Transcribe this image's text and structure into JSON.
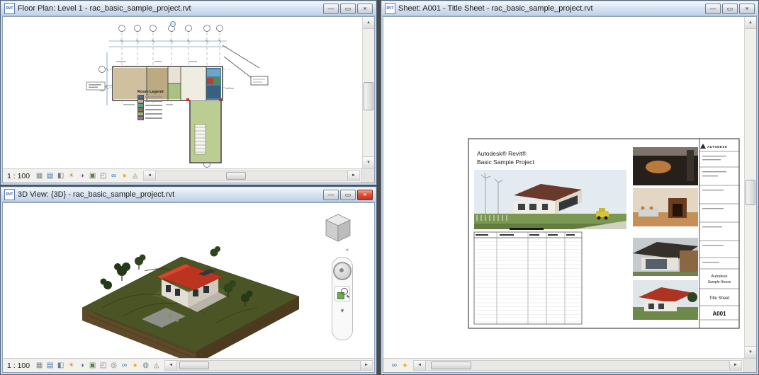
{
  "ui": {
    "window_buttons": {
      "minimize": "—",
      "maximize": "▭",
      "close": "×"
    },
    "scroll_arrows": {
      "left": "◄",
      "right": "►",
      "up": "▲",
      "down": "▼"
    },
    "chevron_down": "▾",
    "file_icon_label": "RVT"
  },
  "windows": {
    "floor_plan": {
      "title": "Floor Plan: Level 1 - rac_basic_sample_project.rvt",
      "scale": "1 : 100",
      "legend": {
        "title": "Room Legend",
        "swatches": [
          "#4a6a9a",
          "#c8b890",
          "#5aa090",
          "#8a7050",
          "#9ab870",
          "#9a6aa0"
        ]
      },
      "view_control_icons": [
        {
          "name": "show-rendering-dialog-icon",
          "glyph": "▦",
          "color": "#7a8288"
        },
        {
          "name": "detail-level-icon",
          "glyph": "▤",
          "color": "#3f6db0"
        },
        {
          "name": "visual-style-icon",
          "glyph": "◧",
          "color": "#6f7b86"
        },
        {
          "name": "sun-path-icon",
          "glyph": "☀",
          "color": "#c99a1e"
        },
        {
          "name": "shadows-icon",
          "glyph": "◑",
          "color": "#566070"
        },
        {
          "name": "crop-view-icon",
          "glyph": "▣",
          "color": "#5c7d4f"
        },
        {
          "name": "crop-region-visibility-icon",
          "glyph": "◰",
          "color": "#7a6899"
        },
        {
          "name": "temporary-hide-isolate-icon",
          "glyph": "∞",
          "color": "#2f6fae"
        },
        {
          "name": "reveal-hidden-elements-icon",
          "glyph": "●",
          "color": "#e5b61f"
        },
        {
          "name": "analytical-model-icon",
          "glyph": "◬",
          "color": "#8a8f6a"
        }
      ]
    },
    "view_3d": {
      "title": "3D View: {3D} - rac_basic_sample_project.rvt",
      "scale": "1 : 100",
      "view_control_icons": [
        {
          "name": "show-rendering-dialog-icon",
          "glyph": "▦",
          "color": "#7a8288"
        },
        {
          "name": "detail-level-icon",
          "glyph": "▤",
          "color": "#3f6db0"
        },
        {
          "name": "visual-style-icon",
          "glyph": "◧",
          "color": "#6f7b86"
        },
        {
          "name": "sun-path-icon",
          "glyph": "☀",
          "color": "#c99a1e"
        },
        {
          "name": "shadows-icon",
          "glyph": "◑",
          "color": "#566070"
        },
        {
          "name": "crop-view-icon",
          "glyph": "▣",
          "color": "#5c7d4f"
        },
        {
          "name": "crop-region-visibility-icon",
          "glyph": "◰",
          "color": "#7a6899"
        },
        {
          "name": "unlocked-view-icon",
          "glyph": "◎",
          "color": "#767676"
        },
        {
          "name": "temporary-hide-isolate-icon",
          "glyph": "∞",
          "color": "#2f6fae"
        },
        {
          "name": "reveal-hidden-elements-icon",
          "glyph": "●",
          "color": "#e5b61f"
        },
        {
          "name": "worksharing-display-icon",
          "glyph": "◍",
          "color": "#6a8a9a"
        },
        {
          "name": "analytical-model-icon",
          "glyph": "◬",
          "color": "#8a8f6a"
        }
      ]
    },
    "sheet": {
      "title": "Sheet: A001 - Title Sheet - rac_basic_sample_project.rvt",
      "heading_line1": "Autodesk® Revit®",
      "heading_line2": "Basic Sample Project",
      "brand": "AUTODESK",
      "titleblock": {
        "project": "Autodesk",
        "model": "Sample House",
        "sheet_name": "Title Sheet",
        "sheet_number": "A001"
      },
      "view_control_icons": [
        {
          "name": "temporary-hide-isolate-icon",
          "glyph": "∞",
          "color": "#2f6fae"
        },
        {
          "name": "reveal-hidden-elements-icon",
          "glyph": "●",
          "color": "#e5b61f"
        }
      ]
    }
  }
}
